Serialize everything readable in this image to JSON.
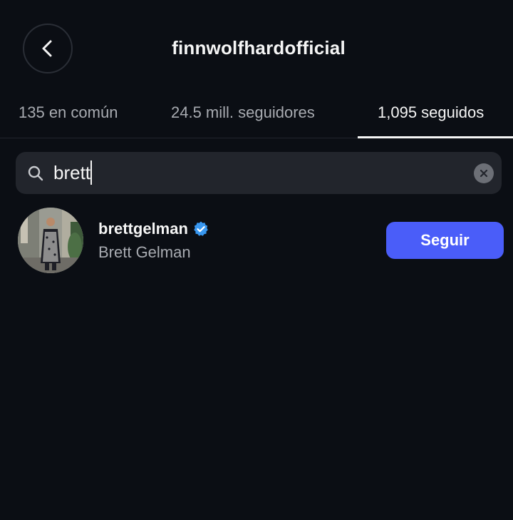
{
  "header": {
    "title": "finnwolfhardofficial"
  },
  "tabs": [
    {
      "label": "135 en común",
      "active": false
    },
    {
      "label": "24.5 mill. seguidores",
      "active": false
    },
    {
      "label": "1,095 seguidos",
      "active": true
    }
  ],
  "search": {
    "value": "brett"
  },
  "results": [
    {
      "username": "brettgelman",
      "verified": true,
      "full_name": "Brett Gelman",
      "button_label": "Seguir"
    }
  ],
  "colors": {
    "background": "#0b0e14",
    "accent_button": "#4a5df9",
    "verified_badge": "#3897f0",
    "search_bg": "#22252c"
  },
  "icons": {
    "back": "chevron-left-icon",
    "search": "search-icon",
    "clear": "clear-icon",
    "verified": "verified-badge-icon"
  }
}
